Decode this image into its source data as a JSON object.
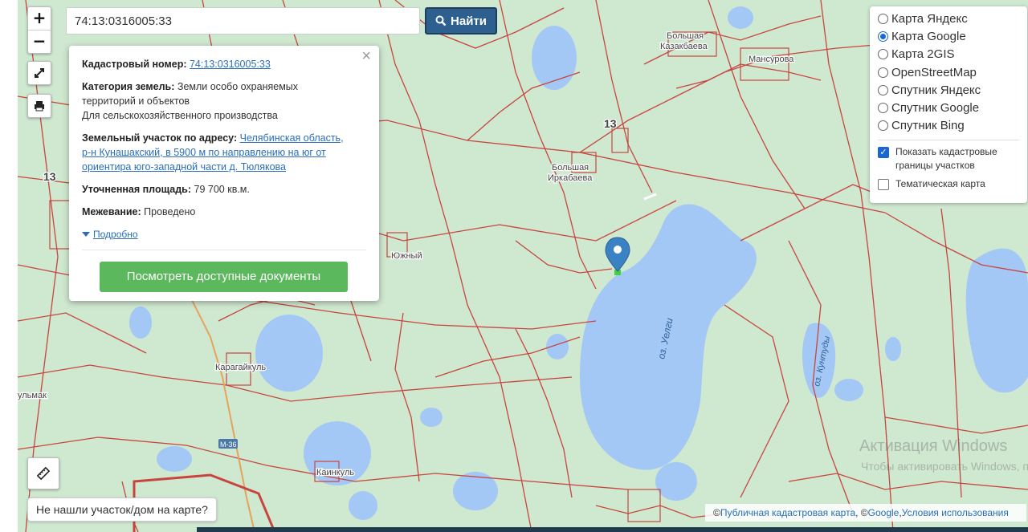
{
  "search": {
    "value": "74:13:0316005:33",
    "button_label": "Найти"
  },
  "zoom": {
    "in_label": "+",
    "out_label": "−"
  },
  "popup": {
    "cadastral_label": "Кадастровый номер:",
    "cadastral_value": "74:13:0316005:33",
    "category_label": "Категория земель:",
    "category_value_line1": "Земли особо охраняемых",
    "category_value_line2": "территорий и объектов",
    "category_value_line3": "Для сельскохозяйственного производства",
    "address_label": "Земельный участок по адресу:",
    "address_value_line1": "Челябинская область,",
    "address_value_line2": "р-н Кунашакский, в 5900 м по направлению на юг от",
    "address_value_line3": "ориентира юго-западной части д. Тюлякова",
    "area_label": "Уточненная площадь:",
    "area_value": "79 700 кв.м.",
    "survey_label": "Межевание:",
    "survey_value": "Проведено",
    "more_label": "Подробно",
    "docs_button": "Посмотреть доступные документы",
    "close_label": "×"
  },
  "layers": {
    "options": [
      "Карта Яндекс",
      "Карта Google",
      "Карта 2GIS",
      "OpenStreetMap",
      "Спутник Яндекс",
      "Спутник Google",
      "Спутник Bing"
    ],
    "selected": "Карта Google",
    "checks": [
      {
        "label": "Показать кадастровые границы участков",
        "checked": true
      },
      {
        "label": "Тематическая карта",
        "checked": false
      }
    ]
  },
  "notfound_label": "Не нашли участок/дом на карте?",
  "attribution": {
    "prefix": "© ",
    "link1": "Публичная кадастровая карта",
    "sep": ", © ",
    "link2": "Google",
    "sep2": ", ",
    "link3": "Условия использования"
  },
  "watermark": {
    "line1": "Активация Windows",
    "line2": "Чтобы активировать Windows, перейдите в раздел «Параметры»."
  },
  "map_labels": {
    "b_kazakbaeva_1": "Большая",
    "b_kazakbaeva_2": "Казакбаева",
    "mansurova": "Мансурова",
    "b_irkabaeva_1": "Большая",
    "b_irkabaeva_2": "Иркабаева",
    "karagaikul": "Карагайкуль",
    "kaikul": "Каинкуль",
    "lake_uelgi": "оз. Уелги",
    "lake_kuntudy": "оз. Кунтуды",
    "road_13_a": "13",
    "road_13_b": "13",
    "road_m36": "М-36",
    "yuzhny": "Южный",
    "ulmak": "ульмак"
  },
  "colors": {
    "map_bg": "#cfe8d0",
    "water": "#a3c8f5",
    "parcel": "#c8453f",
    "accent": "#2d5f8f",
    "button_green": "#5cb85c"
  },
  "icons": [
    "zoom-in-icon",
    "zoom-out-icon",
    "fullscreen-icon",
    "print-icon",
    "search-icon",
    "ruler-icon",
    "map-pin-icon"
  ]
}
